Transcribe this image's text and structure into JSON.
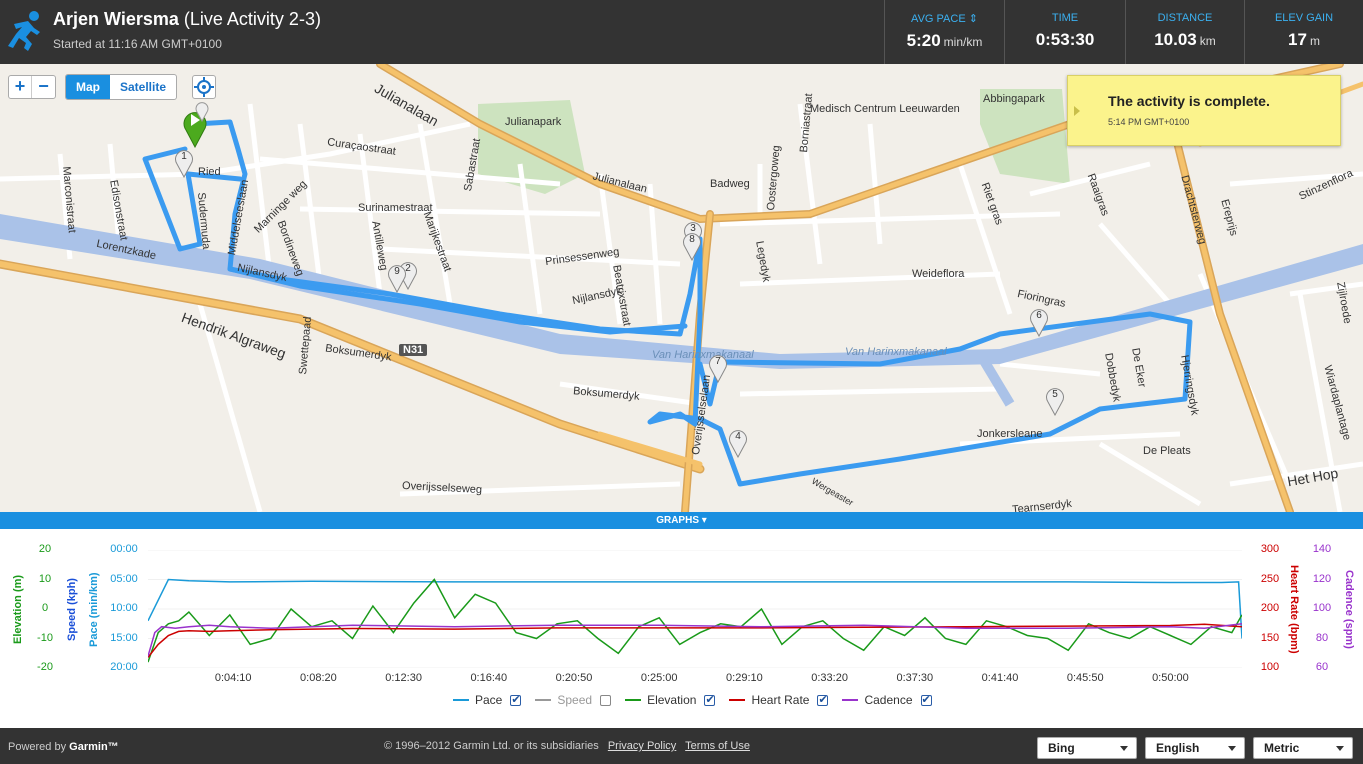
{
  "header": {
    "athlete": "Arjen Wiersma",
    "activity": "(Live Activity 2-3)",
    "started": "Started at 11:16 AM GMT+0100",
    "stats": [
      {
        "label": "AVG PACE ⇕",
        "value": "5:20",
        "unit": "min/km"
      },
      {
        "label": "TIME",
        "value": "0:53:30",
        "unit": ""
      },
      {
        "label": "DISTANCE",
        "value": "10.03",
        "unit": "km"
      },
      {
        "label": "ELEV GAIN",
        "value": "17",
        "unit": "m"
      }
    ]
  },
  "map": {
    "zoom_in": "+",
    "zoom_out": "−",
    "map_tab": "Map",
    "satellite_tab": "Satellite",
    "notice_title": "The activity is complete.",
    "notice_time": "5:14 PM GMT+0100",
    "labels": {
      "julianalaan": "Julianalaan",
      "julianalaan2": "Julianalaan",
      "julianapark": "Julianapark",
      "medisch": "Medisch Centrum Leeuwarden",
      "abbingapark": "Abbingapark",
      "curacao": "Curaçaostraat",
      "surinamestraat": "Surinamestraat",
      "marijkestraat": "Marijkestraat",
      "sabastraat": "Sabastraat",
      "badweg": "Badweg",
      "oostergoweg": "Oostergoweg",
      "bornia": "Borniastraat",
      "prinsessenweg": "Prinsessenweg",
      "nijlansdyk": "Nijlansdyk",
      "nijlansdyk2": "Nijlansdyk",
      "beatrixstraat": "Beatrixstraat",
      "legedyk": "Legedyk",
      "weideflora": "Weideflora",
      "fioringras": "Fioringras",
      "rietgras": "Riet gras",
      "raaigras": "Raaigras",
      "drachtsterweg": "Drachtsterweg",
      "stinzenflora": "Stinzenflora",
      "ereprijs": "Ereprijs",
      "hendrik": "Hendrik Algraweg",
      "boksumerdyk": "Boksumerdyk",
      "boksumerdyk2": "Boksumerdyk",
      "n31": "N31",
      "swettepaad": "Swettepaad",
      "canal1": "Van Harinxmakanaal",
      "canal2": "Van Harinxmakanaal",
      "overijsselseweg": "Overijsselseweg",
      "overijsselselaan": "Overijsselselaan",
      "jonkersleane": "Jonkersleane",
      "depleats": "De Pleats",
      "hetHop": "Het Hop",
      "wiardaplantage": "Wiardaplantage",
      "tearnserdyk": "Tearnserdyk",
      "deeker": "De Eker",
      "marconistraat": "Marconistraat",
      "edisonstraat": "Edisonstraat",
      "lorentzkade": "Lorentzkade",
      "sudermuda": "Sudermuda",
      "middelsee": "Middelseeslaan",
      "marninge": "Marninge weg",
      "bordine": "Bordineweg",
      "antilleweg": "Antilleweg",
      "ried": "Ried",
      "zijlroede": "Zijlroede",
      "hjerringsdyk": "Hjerringsdyk",
      "dobbedyk": "Dobbedyk",
      "wergea": "Wergeaster"
    },
    "markers": [
      "1",
      "2",
      "3",
      "4",
      "5",
      "6",
      "7",
      "8",
      "9"
    ]
  },
  "graphs_bar": "GRAPHS ▾",
  "chart_data": {
    "type": "line",
    "x_ticks": [
      "0:04:10",
      "0:08:20",
      "0:12:30",
      "0:16:40",
      "0:20:50",
      "0:25:00",
      "0:29:10",
      "0:33:20",
      "0:37:30",
      "0:41:40",
      "0:45:50",
      "0:50:00"
    ],
    "x_range_seconds": [
      0,
      3210
    ],
    "axes": {
      "elevation": {
        "label": "Elevation (m)",
        "ticks": [
          "20",
          "10",
          "0",
          "-10",
          "-20"
        ],
        "range": [
          -20,
          20
        ],
        "color": "#1a9a1a"
      },
      "speed": {
        "label": "Speed (kph)",
        "color": "#1a4fd8"
      },
      "pace": {
        "label": "Pace (min/km)",
        "ticks": [
          "00:00",
          "05:00",
          "10:00",
          "15:00",
          "20:00"
        ],
        "range": [
          0,
          20
        ],
        "color": "#1a9ad8"
      },
      "heart_rate": {
        "label": "Heart Rate (bpm)",
        "ticks": [
          "300",
          "250",
          "200",
          "150",
          "100"
        ],
        "range": [
          100,
          300
        ],
        "color": "#cc0000"
      },
      "cadence": {
        "label": "Cadence (spm)",
        "ticks": [
          "140",
          "120",
          "100",
          "80",
          "60"
        ],
        "range": [
          60,
          140
        ],
        "color": "#9933cc"
      }
    },
    "series": [
      {
        "name": "Pace",
        "color": "#1a9ad8",
        "checked": true,
        "x": [
          0,
          60,
          120,
          240,
          480,
          900,
          1500,
          2100,
          2700,
          3000,
          3150,
          3200,
          3210
        ],
        "values": [
          12,
          5.0,
          5.2,
          5.4,
          5.3,
          5.4,
          5.4,
          5.4,
          5.4,
          5.5,
          5.5,
          5.4,
          15
        ]
      },
      {
        "name": "Speed",
        "color": "#999999",
        "checked": false,
        "x": [],
        "values": []
      },
      {
        "name": "Elevation",
        "color": "#1a9a1a",
        "checked": true,
        "x": [
          0,
          30,
          60,
          90,
          120,
          180,
          240,
          300,
          360,
          420,
          480,
          540,
          600,
          660,
          720,
          780,
          840,
          900,
          960,
          1020,
          1080,
          1140,
          1200,
          1260,
          1320,
          1380,
          1440,
          1500,
          1560,
          1620,
          1680,
          1740,
          1800,
          1860,
          1920,
          1980,
          2040,
          2100,
          2160,
          2220,
          2280,
          2340,
          2400,
          2460,
          2520,
          2580,
          2640,
          2700,
          2760,
          2820,
          2880,
          2940,
          3000,
          3060,
          3120,
          3180,
          3210
        ],
        "values": [
          -18,
          -8,
          -5,
          -4,
          -1,
          -9,
          -2,
          -12,
          -10,
          0,
          -6,
          -4,
          -10,
          1,
          -8,
          2,
          10,
          -3,
          5,
          2,
          -8,
          -10,
          -5,
          -4,
          -10,
          -15,
          -6,
          -3,
          -12,
          -8,
          -5,
          -6,
          0,
          -12,
          -6,
          -4,
          -10,
          -14,
          -6,
          -9,
          -3,
          -10,
          -12,
          -4,
          -6,
          -9,
          -10,
          -14,
          -5,
          -8,
          -10,
          -6,
          -9,
          -12,
          -6,
          -8,
          -2
        ]
      },
      {
        "name": "Heart Rate",
        "color": "#cc0000",
        "checked": true,
        "x": [
          0,
          30,
          60,
          90,
          120,
          180,
          240,
          360,
          480,
          600,
          900,
          1200,
          1500,
          1800,
          2100,
          2400,
          2700,
          3000,
          3100,
          3210
        ],
        "values": [
          118,
          140,
          155,
          162,
          163,
          162,
          163,
          165,
          166,
          167,
          166,
          168,
          168,
          168,
          169,
          170,
          171,
          172,
          174,
          170
        ]
      },
      {
        "name": "Cadence",
        "color": "#9933cc",
        "checked": true,
        "x": [
          0,
          20,
          40,
          80,
          120,
          180,
          240,
          360,
          480,
          600,
          900,
          1200,
          1500,
          1800,
          2100,
          2400,
          2700,
          3000,
          3100,
          3210
        ],
        "values": [
          68,
          84,
          88,
          87,
          88,
          89,
          88,
          87,
          88,
          89,
          88,
          89,
          89,
          88,
          89,
          87,
          87,
          88,
          87,
          90
        ]
      }
    ]
  },
  "footer": {
    "powered": "Powered by",
    "brand": "Garmin™",
    "copyright": "© 1996–2012 Garmin Ltd. or its subsidiaries",
    "privacy": "Privacy Policy",
    "terms": "Terms of Use",
    "map_provider": "Bing",
    "language": "English",
    "units": "Metric"
  }
}
